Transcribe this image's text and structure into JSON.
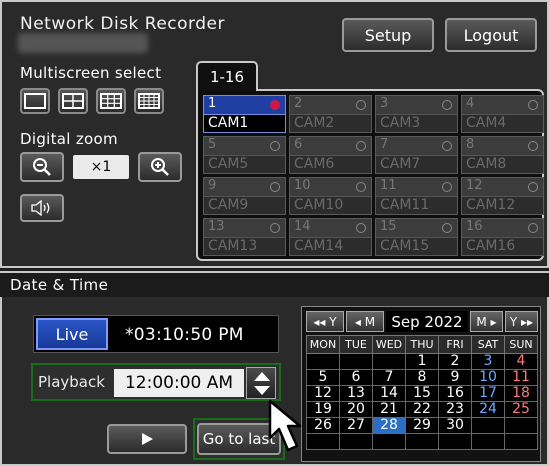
{
  "header": {
    "app_title": "Network Disk Recorder",
    "setup_label": "Setup",
    "logout_label": "Logout"
  },
  "multiscreen": {
    "label": "Multiscreen select"
  },
  "digital_zoom": {
    "label": "Digital zoom",
    "value": "×1"
  },
  "tab": {
    "label": "1-16"
  },
  "cameras": [
    {
      "num": "1",
      "name": "CAM1",
      "active": true
    },
    {
      "num": "2",
      "name": "CAM2"
    },
    {
      "num": "3",
      "name": "CAM3"
    },
    {
      "num": "4",
      "name": "CAM4"
    },
    {
      "num": "5",
      "name": "CAM5"
    },
    {
      "num": "6",
      "name": "CAM6"
    },
    {
      "num": "7",
      "name": "CAM7"
    },
    {
      "num": "8",
      "name": "CAM8"
    },
    {
      "num": "9",
      "name": "CAM9"
    },
    {
      "num": "10",
      "name": "CAM10"
    },
    {
      "num": "11",
      "name": "CAM11"
    },
    {
      "num": "12",
      "name": "CAM12"
    },
    {
      "num": "13",
      "name": "CAM13"
    },
    {
      "num": "14",
      "name": "CAM14"
    },
    {
      "num": "15",
      "name": "CAM15"
    },
    {
      "num": "16",
      "name": "CAM16"
    }
  ],
  "datetime": {
    "label": "Date & Time",
    "live_label": "Live",
    "live_time": "*03:10:50 PM",
    "playback_label": "Playback",
    "playback_time": "12:00:00 AM",
    "goto_label": "Go to last"
  },
  "calendar": {
    "prev_year": "◂◂ Y",
    "prev_month": "◂ M",
    "month_label": "Sep 2022",
    "next_month": "M ▸",
    "next_year": "Y ▸▸",
    "weekdays": [
      "MON",
      "TUE",
      "WED",
      "THU",
      "FRI",
      "SAT",
      "SUN"
    ],
    "weeks": [
      [
        "",
        "",
        "",
        "1",
        "2",
        "3",
        "4"
      ],
      [
        "5",
        "6",
        "7",
        "8",
        "9",
        "10",
        "11"
      ],
      [
        "12",
        "13",
        "14",
        "15",
        "16",
        "17",
        "18"
      ],
      [
        "19",
        "20",
        "21",
        "22",
        "23",
        "24",
        "25"
      ],
      [
        "26",
        "27",
        "28",
        "29",
        "30",
        "",
        ""
      ],
      [
        "",
        "",
        "",
        "",
        "",
        "",
        ""
      ]
    ],
    "selected_day": "28",
    "colors": {
      "selected": "#2a6fc4",
      "saturday": "#6ea8ff",
      "sunday": "#ff7b7b"
    }
  }
}
